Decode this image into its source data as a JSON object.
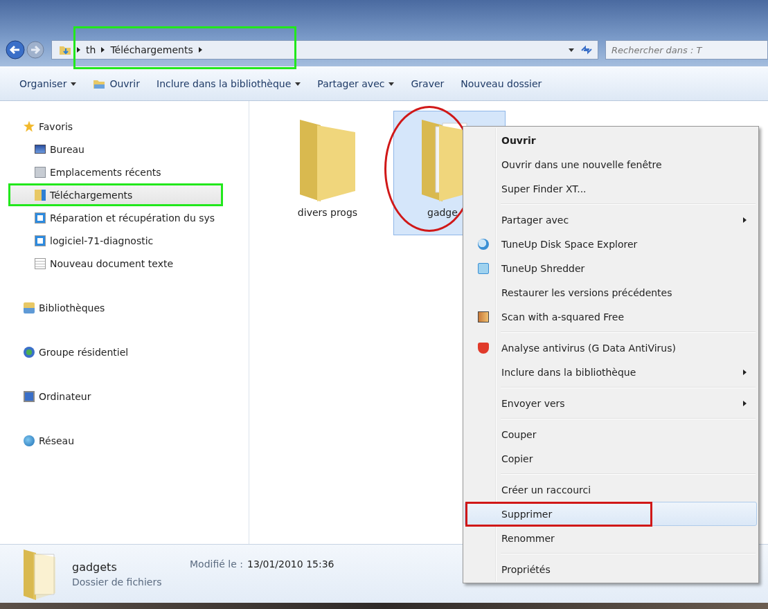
{
  "address_bar": {
    "crumbs": [
      "th",
      "Téléchargements"
    ],
    "highlighted": true
  },
  "search": {
    "placeholder": "Rechercher dans : T"
  },
  "toolbar": [
    {
      "label": "Organiser",
      "dropdown": true
    },
    {
      "label": "Ouvrir",
      "dropdown": false
    },
    {
      "label": "Inclure dans la bibliothèque",
      "dropdown": true
    },
    {
      "label": "Partager avec",
      "dropdown": true
    },
    {
      "label": "Graver",
      "dropdown": false
    },
    {
      "label": "Nouveau dossier",
      "dropdown": false
    }
  ],
  "sidebar": {
    "items": [
      {
        "label": "Favoris",
        "selected": false,
        "highlighted": false,
        "children": [
          {
            "label": "Bureau",
            "selected": false,
            "highlighted": false
          },
          {
            "label": "Emplacements récents",
            "selected": false,
            "highlighted": false
          },
          {
            "label": "Téléchargements",
            "selected": true,
            "highlighted": true
          },
          {
            "label": "Réparation et récupération du sys",
            "selected": false,
            "highlighted": false
          },
          {
            "label": "logiciel-71-diagnostic",
            "selected": false,
            "highlighted": false
          },
          {
            "label": "Nouveau document texte",
            "selected": false,
            "highlighted": false
          }
        ]
      },
      {
        "label": "Bibliothèques",
        "selected": false,
        "highlighted": false
      },
      {
        "label": "Groupe résidentiel",
        "selected": false,
        "highlighted": false
      },
      {
        "label": "Ordinateur",
        "selected": false,
        "highlighted": false
      },
      {
        "label": "Réseau",
        "selected": false,
        "highlighted": false
      }
    ]
  },
  "files": [
    {
      "name": "divers progs",
      "selected": false,
      "circled": false
    },
    {
      "name": "gadge",
      "selected": true,
      "circled": true
    }
  ],
  "context_menu": {
    "items": [
      {
        "kind": "item",
        "label": "Ouvrir",
        "default": true,
        "submenu": false,
        "boxed": false,
        "hover": false
      },
      {
        "kind": "item",
        "label": "Ouvrir dans une nouvelle fenêtre",
        "default": false,
        "submenu": false,
        "boxed": false,
        "hover": false
      },
      {
        "kind": "item",
        "label": "Super Finder XT...",
        "default": false,
        "submenu": false,
        "boxed": false,
        "hover": false
      },
      {
        "kind": "separator"
      },
      {
        "kind": "item",
        "label": "Partager avec",
        "default": false,
        "submenu": true,
        "boxed": false,
        "hover": false
      },
      {
        "kind": "item",
        "label": "TuneUp Disk Space Explorer",
        "default": false,
        "submenu": false,
        "boxed": false,
        "hover": false
      },
      {
        "kind": "item",
        "label": "TuneUp Shredder",
        "default": false,
        "submenu": false,
        "boxed": false,
        "hover": false
      },
      {
        "kind": "item",
        "label": "Restaurer les versions précédentes",
        "default": false,
        "submenu": false,
        "boxed": false,
        "hover": false
      },
      {
        "kind": "item",
        "label": "Scan with a-squared Free",
        "default": false,
        "submenu": false,
        "boxed": false,
        "hover": false
      },
      {
        "kind": "separator"
      },
      {
        "kind": "item",
        "label": "Analyse antivirus (G Data AntiVirus)",
        "default": false,
        "submenu": false,
        "boxed": false,
        "hover": false
      },
      {
        "kind": "item",
        "label": "Inclure dans la bibliothèque",
        "default": false,
        "submenu": true,
        "boxed": false,
        "hover": false
      },
      {
        "kind": "separator"
      },
      {
        "kind": "item",
        "label": "Envoyer vers",
        "default": false,
        "submenu": true,
        "boxed": false,
        "hover": false
      },
      {
        "kind": "separator"
      },
      {
        "kind": "item",
        "label": "Couper",
        "default": false,
        "submenu": false,
        "boxed": false,
        "hover": false
      },
      {
        "kind": "item",
        "label": "Copier",
        "default": false,
        "submenu": false,
        "boxed": false,
        "hover": false
      },
      {
        "kind": "separator"
      },
      {
        "kind": "item",
        "label": "Créer un raccourci",
        "default": false,
        "submenu": false,
        "boxed": false,
        "hover": false
      },
      {
        "kind": "item",
        "label": "Supprimer",
        "default": false,
        "submenu": false,
        "boxed": true,
        "hover": true
      },
      {
        "kind": "item",
        "label": "Renommer",
        "default": false,
        "submenu": false,
        "boxed": false,
        "hover": false
      },
      {
        "kind": "separator"
      },
      {
        "kind": "item",
        "label": "Propriétés",
        "default": false,
        "submenu": false,
        "boxed": false,
        "hover": false
      }
    ]
  },
  "details": {
    "name": "gadgets",
    "type": "Dossier de fichiers",
    "modified_label": "Modifié le :",
    "modified_value": "13/01/2010 15:36"
  }
}
